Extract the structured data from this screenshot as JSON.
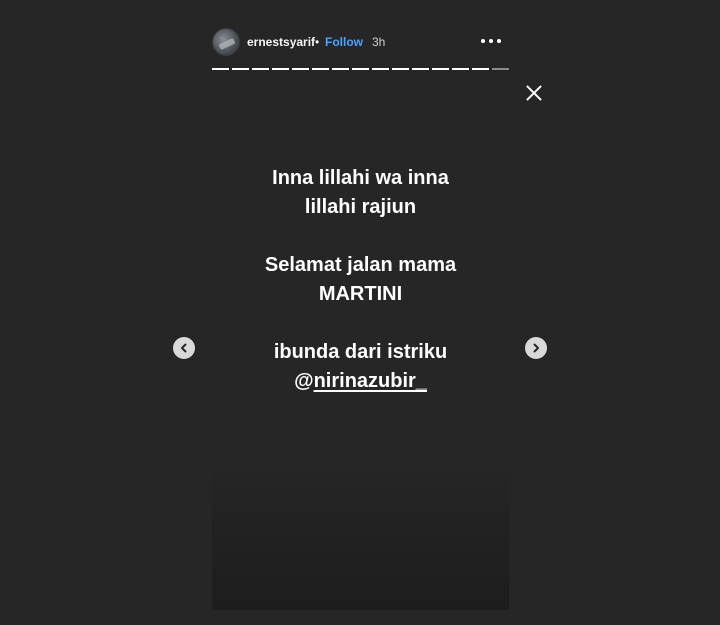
{
  "header": {
    "username": "ernestsyarif",
    "separator": "•",
    "follow_label": "Follow",
    "time": "3h",
    "more_icon": "more-options-icon"
  },
  "progress": {
    "segments_total": 15,
    "current_segment": 15
  },
  "story": {
    "line1": "Inna lillahi wa inna",
    "line2": "lillahi rajiun",
    "line3": "Selamat jalan mama",
    "line4": "MARTINI",
    "line5": "ibunda dari istriku",
    "mention_prefix": "@",
    "mention_handle": "nirinazubir_"
  },
  "colors": {
    "background": "#262626",
    "follow": "#4aa3ff",
    "text": "#ffffff"
  }
}
